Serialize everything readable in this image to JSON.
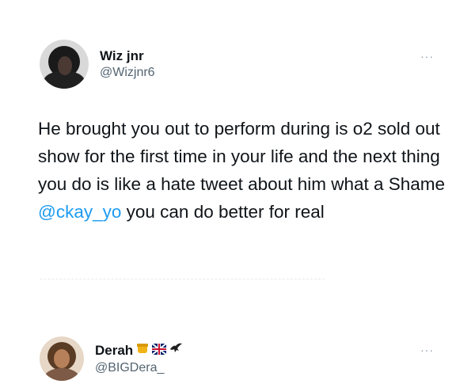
{
  "tweet": {
    "display_name": "Wiz jnr",
    "handle": "@Wizjnr6",
    "text_before": "He brought you out to perform during is o2 sold out show for the first time in your life and the next thing you do is like a hate tweet about him what a Shame ",
    "mention": "@ckay_yo",
    "text_after": " you can do better for real",
    "more_label": "···"
  },
  "reply": {
    "display_name": "Derah",
    "handle": "@BIGDera_",
    "more_label": "···",
    "badges": [
      "honey-pot-emoji",
      "uk-flag-emoji",
      "eagle-emoji"
    ]
  },
  "colors": {
    "text": "#0f1419",
    "secondary": "#536471",
    "link": "#1d9bf0"
  }
}
